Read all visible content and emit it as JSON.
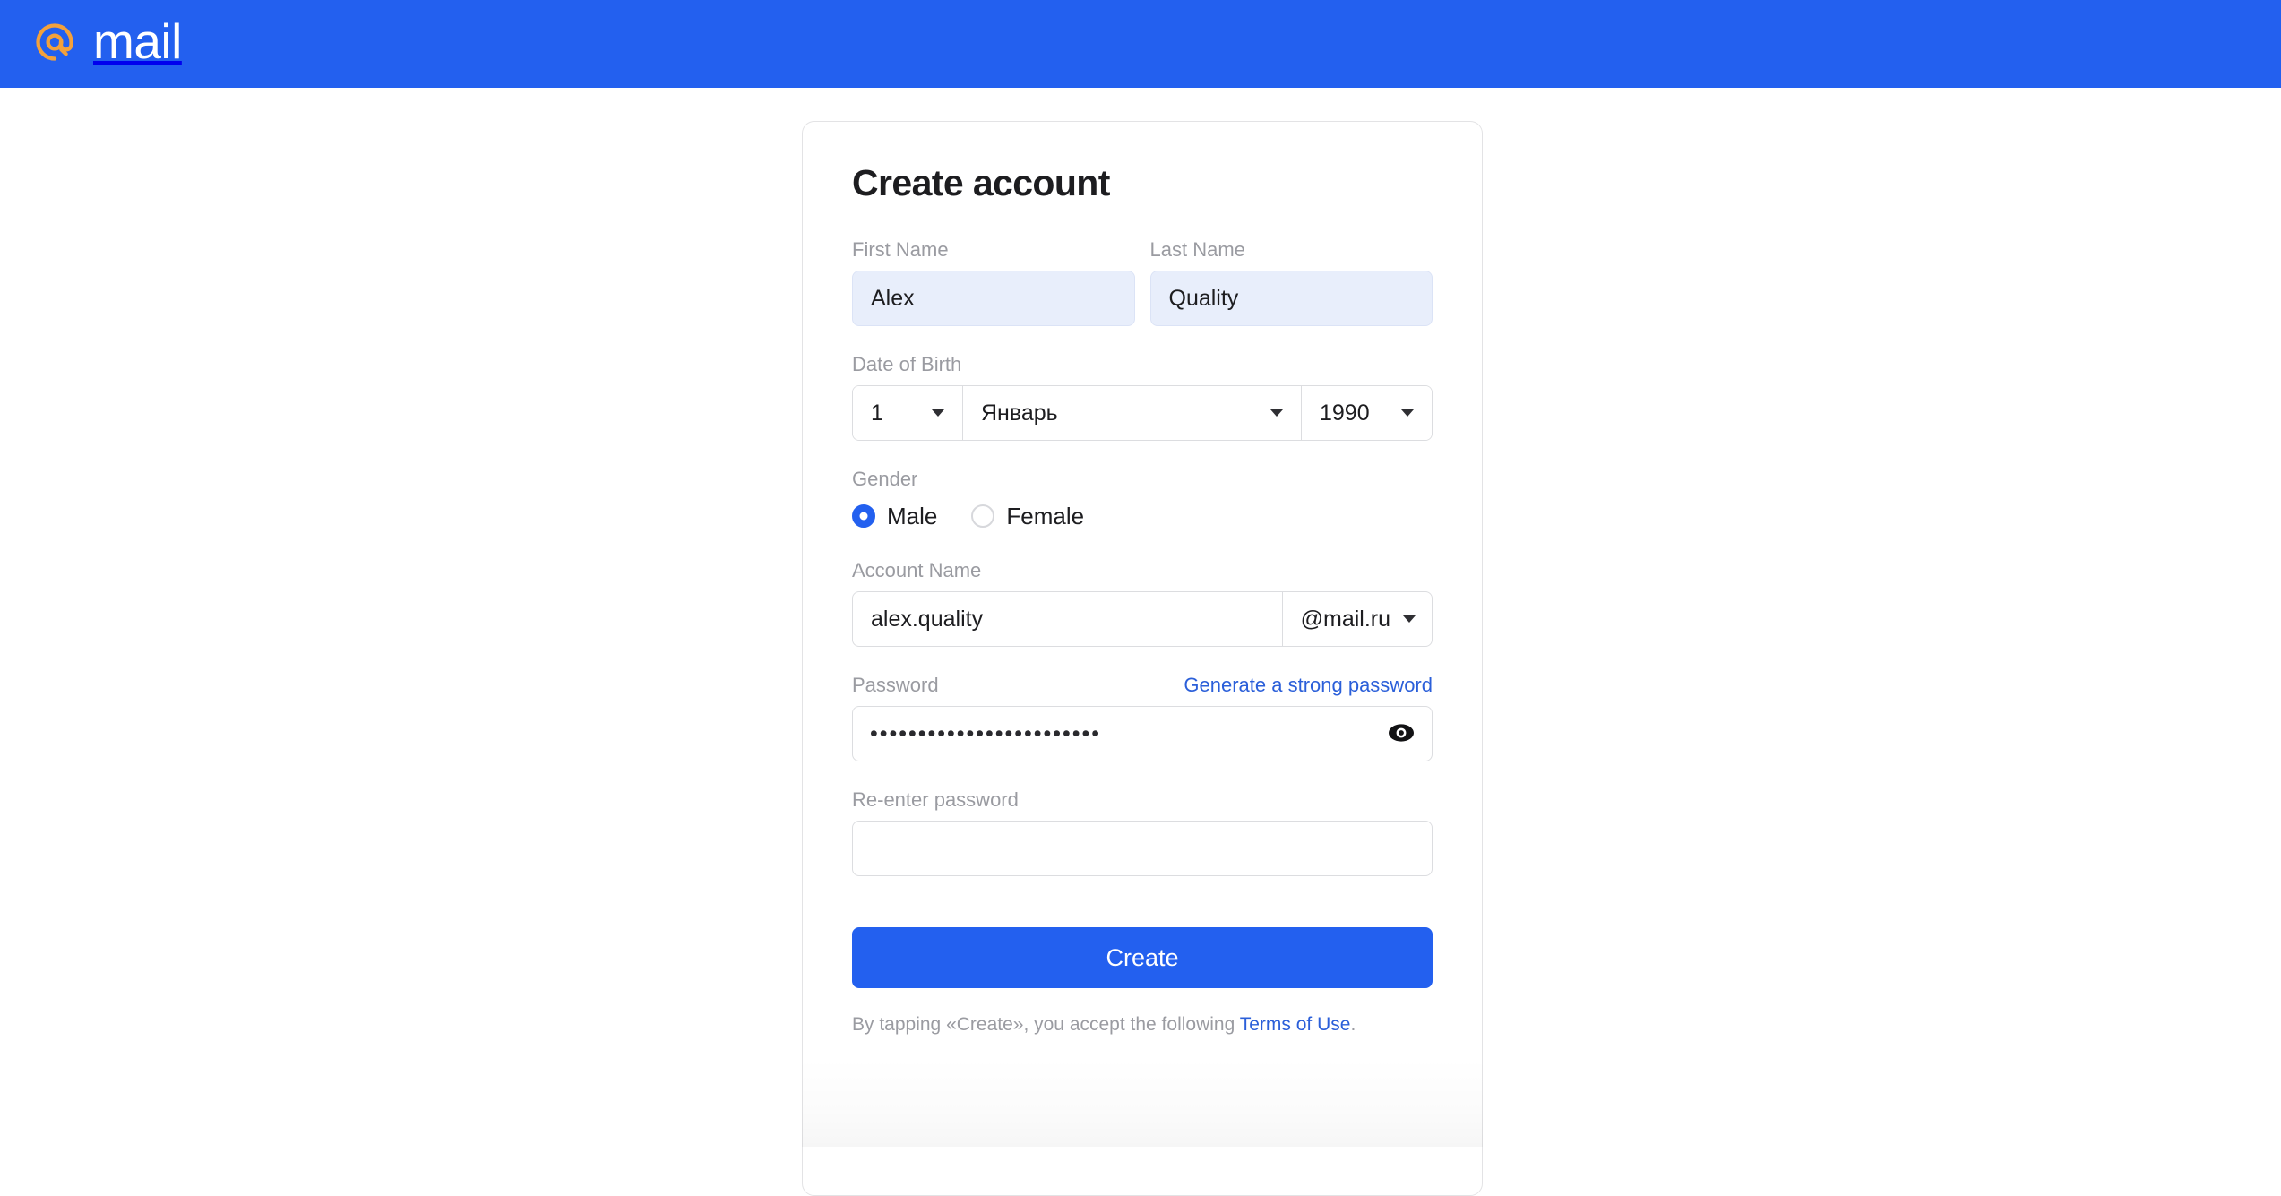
{
  "colors": {
    "brand_blue": "#2360ef",
    "link_blue": "#2b5fd9",
    "logo_orange": "#f3a13c",
    "autofill_bg": "#e8eefb",
    "label_grey": "#9a9ba1",
    "border_grey": "#dcdde0",
    "text_dark": "#1d1d20"
  },
  "header": {
    "logo_at_icon": "at-sign-icon",
    "logo_word": "mail"
  },
  "form": {
    "title": "Create account",
    "first_name": {
      "label": "First Name",
      "value": "Alex",
      "placeholder": "",
      "autofilled": true
    },
    "last_name": {
      "label": "Last Name",
      "value": "Quality",
      "placeholder": "",
      "autofilled": true
    },
    "date_of_birth": {
      "label": "Date of Birth",
      "day": {
        "value": "1",
        "options": [
          "1",
          "2",
          "3",
          "4",
          "5",
          "6",
          "7",
          "8",
          "9",
          "10",
          "11",
          "12",
          "13",
          "14",
          "15",
          "16",
          "17",
          "18",
          "19",
          "20",
          "21",
          "22",
          "23",
          "24",
          "25",
          "26",
          "27",
          "28",
          "29",
          "30",
          "31"
        ]
      },
      "month": {
        "value": "Январь",
        "options": [
          "Январь",
          "Февраль",
          "Март",
          "Апрель",
          "Май",
          "Июнь",
          "Июль",
          "Август",
          "Сентябрь",
          "Октябрь",
          "Ноябрь",
          "Декабрь"
        ]
      },
      "year": {
        "value": "1990",
        "options": [
          "1990",
          "1991",
          "1992",
          "1993",
          "1994",
          "1995"
        ]
      },
      "caret_icon": "chevron-down-icon"
    },
    "gender": {
      "label": "Gender",
      "selected": "Male",
      "options": [
        {
          "label": "Male",
          "selected": true
        },
        {
          "label": "Female",
          "selected": false
        }
      ]
    },
    "account_name": {
      "label": "Account Name",
      "value": "alex.quality",
      "placeholder": "",
      "domain": {
        "value": "@mail.ru",
        "options": [
          "@mail.ru",
          "@inbox.ru",
          "@list.ru",
          "@bk.ru",
          "@internet.ru"
        ],
        "caret_icon": "chevron-down-icon"
      }
    },
    "password": {
      "label": "Password",
      "generate_link": "Generate a strong password",
      "masked_value": "••••••••••••••••••••••••",
      "char_count": 24,
      "reveal_icon": "eye-icon",
      "placeholder": ""
    },
    "repeat_password": {
      "label": "Re-enter password",
      "value": "",
      "placeholder": ""
    },
    "submit_label": "Create",
    "terms": {
      "prefix": "By tapping «Create», you accept the following ",
      "link_text": "Terms of Use",
      "suffix": "."
    }
  }
}
